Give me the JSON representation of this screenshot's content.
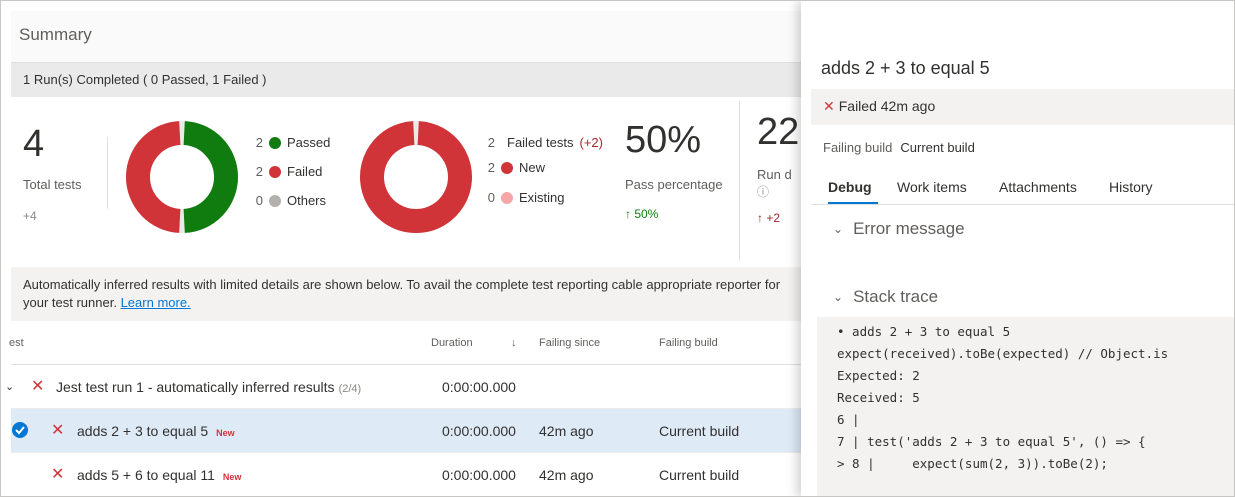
{
  "summary": {
    "title": "Summary",
    "runs_text": "1 Run(s) Completed ( 0 Passed, 1 Failed )"
  },
  "stats": {
    "total": "4",
    "total_label": "Total tests",
    "total_delta": "+4",
    "outcome_legend": [
      {
        "count": "2",
        "label": "Passed",
        "color": "#107c10"
      },
      {
        "count": "2",
        "label": "Failed",
        "color": "#d13438"
      },
      {
        "count": "0",
        "label": "Others",
        "color": "#b3b0ad"
      }
    ],
    "failed_legend": {
      "count": "2",
      "label": "Failed tests",
      "delta": "(+2)",
      "items": [
        {
          "count": "2",
          "label": "New",
          "color": "#d13438"
        },
        {
          "count": "0",
          "label": "Existing",
          "color": "#f4a6a8"
        }
      ]
    },
    "pass_pct": "50%",
    "pass_label": "Pass percentage",
    "pass_delta": "↑ 50%",
    "run_duration": "22",
    "run_label": "Run d",
    "run_delta": "↑ +2"
  },
  "donuts": {
    "outcome": {
      "passed": 2,
      "failed": 2,
      "others": 0
    },
    "failed": {
      "new": 2,
      "existing": 0
    }
  },
  "info": {
    "text": "Automatically inferred results with limited details are shown below. To avail the complete test reporting cable appropriate reporter for your test runner.",
    "link": "Learn more."
  },
  "table": {
    "headers": {
      "test": "est",
      "duration": "Duration",
      "sort": "↓",
      "failing_since": "Failing since",
      "failing_build": "Failing build"
    },
    "group": {
      "label": "Jest test run 1 - automatically inferred results",
      "count": "(2/4)",
      "duration": "0:00:00.000"
    },
    "rows": [
      {
        "name": "adds 2 + 3 to equal 5",
        "tag": "New",
        "duration": "0:00:00.000",
        "since": "42m ago",
        "build": "Current build"
      },
      {
        "name": "adds 5 + 6 to equal 11",
        "tag": "New",
        "duration": "0:00:00.000",
        "since": "42m ago",
        "build": "Current build"
      }
    ]
  },
  "panel": {
    "title": "adds 2 + 3 to equal 5",
    "status": "Failed 42m ago",
    "failing_build_label": "Failing build",
    "failing_build_value": "Current build",
    "tabs": [
      "Debug",
      "Work items",
      "Attachments",
      "History"
    ],
    "error_section": "Error message",
    "stack_section": "Stack trace",
    "stack_lines": [
      "• adds 2 + 3 to equal 5",
      "expect(received).toBe(expected) // Object.is",
      "Expected: 2",
      "Received: 5",
      "6 |",
      "7 | test('adds 2 + 3 to equal 5', () => {",
      "> 8 |     expect(sum(2, 3)).toBe(2);"
    ]
  },
  "colors": {
    "accent": "#0078d4",
    "passed": "#107c10",
    "failed": "#d13438"
  }
}
